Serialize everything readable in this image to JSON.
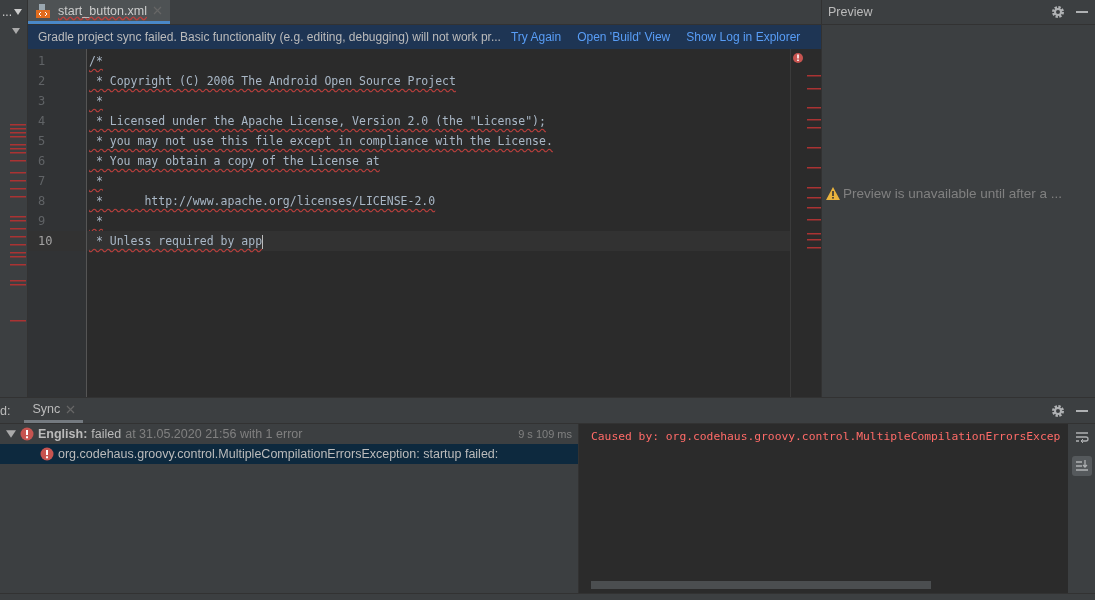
{
  "left_strip": {
    "menu": "..."
  },
  "editor_tab": {
    "label": "start_button.xml",
    "selected": true
  },
  "notification": {
    "message": "Gradle project sync failed. Basic functionality (e.g. editing, debugging) will not work pr...",
    "links": [
      "Try Again",
      "Open 'Build' View",
      "Show Log in Explorer"
    ]
  },
  "code_lines": [
    {
      "number": "1",
      "text": "/*",
      "current": false
    },
    {
      "number": "2",
      "text": " * Copyright (C) 2006 The Android Open Source Project",
      "current": false
    },
    {
      "number": "3",
      "text": " *",
      "current": false
    },
    {
      "number": "4",
      "text": " * Licensed under the Apache License, Version 2.0 (the \"License\");",
      "current": false
    },
    {
      "number": "5",
      "text": " * you may not use this file except in compliance with the License.",
      "current": false
    },
    {
      "number": "6",
      "text": " * You may obtain a copy of the License at",
      "current": false
    },
    {
      "number": "7",
      "text": " *",
      "current": false
    },
    {
      "number": "8",
      "text": " *      http://www.apache.org/licenses/LICENSE-2.0",
      "current": false
    },
    {
      "number": "9",
      "text": " *",
      "current": false
    },
    {
      "number": "10",
      "text": " * Unless required by app",
      "current": true
    }
  ],
  "preview": {
    "title": "Preview",
    "message": "Preview is unavailable until after a ..."
  },
  "build_panel": {
    "label": "d:",
    "tabs": [
      {
        "label": "Sync",
        "selected": true
      }
    ],
    "tree": [
      {
        "name": "English:",
        "status": "failed",
        "detail": "at 31.05.2020 21:56 with 1 error",
        "time": "9 s 109 ms",
        "expanded": true,
        "selected": false,
        "children": [
          {
            "name": "org.codehaus.groovy.control.MultipleCompilationErrorsException: startup failed:",
            "selected": true
          }
        ]
      }
    ],
    "console": [
      "Caused by: org.codehaus.groovy.control.MultipleCompilationErrorsExcep"
    ]
  }
}
